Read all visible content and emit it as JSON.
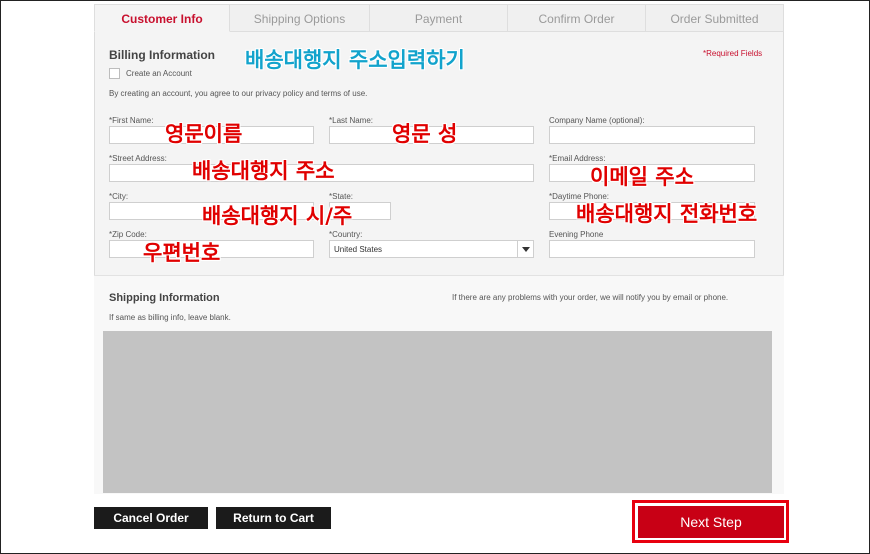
{
  "tabs": [
    "Customer Info",
    "Shipping Options",
    "Payment",
    "Confirm Order",
    "Order Submitted"
  ],
  "billing": {
    "title": "Billing Information",
    "required_note": "*Required Fields",
    "create_account_label": "Create an Account",
    "agreement_text": "By creating an account, you agree to our privacy policy and terms of use."
  },
  "fields": {
    "first_name": "*First Name:",
    "last_name": "*Last Name:",
    "company": "Company Name (optional):",
    "street": "*Street Address:",
    "email": "*Email Address:",
    "city": "*City:",
    "state": "*State:",
    "daytime_phone": "*Daytime Phone:",
    "zip": "*Zip Code:",
    "country": "*Country:",
    "country_value": "United States",
    "evening_phone": "Evening Phone"
  },
  "shipping": {
    "title": "Shipping Information",
    "note": "If there are any problems with your order, we will notify you by email or phone.",
    "blank_note": "If same as billing info, leave blank."
  },
  "annotations": {
    "heading": "배송대행지 주소입력하기",
    "first_name": "영문이름",
    "last_name": "영문 성",
    "street": "배송대행지 주소",
    "email": "이메일 주소",
    "city_state": "배송대행지 시/주",
    "phone": "배송대행지 전화번호",
    "zip": "우편번호"
  },
  "buttons": {
    "cancel": "Cancel Order",
    "return": "Return to Cart",
    "next": "Next Step"
  },
  "colors": {
    "accent": "#c8102e",
    "annotation_red": "#e00000",
    "annotation_blue": "#12a3cc",
    "next_button": "#c80015",
    "dark_button": "#1b1b1b"
  }
}
